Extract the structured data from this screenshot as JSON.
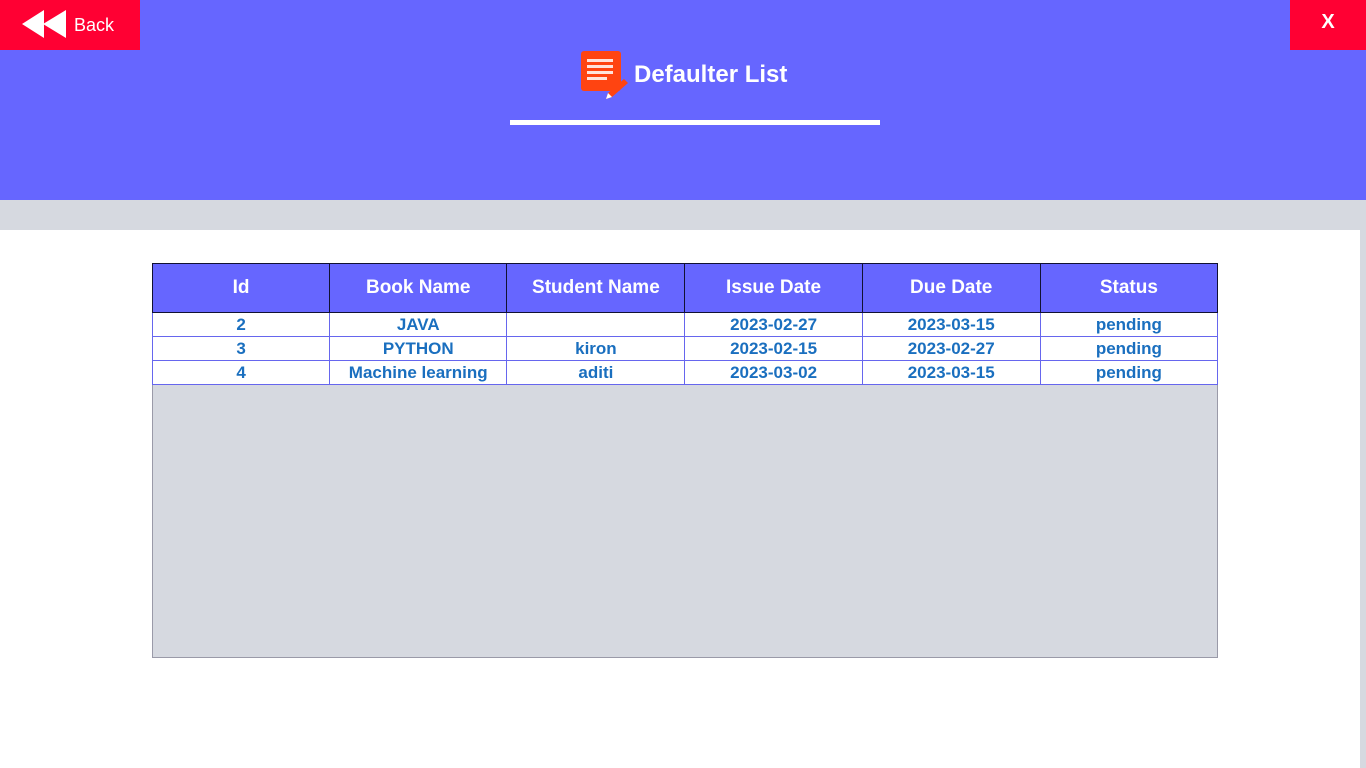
{
  "header": {
    "back_label": "Back",
    "close_label": "X",
    "title": "Defaulter List"
  },
  "colors": {
    "header_bg": "#6666ff",
    "button_bg": "#ff0033",
    "cell_text": "#1a6fbf",
    "grid_bg": "#d6d9e0",
    "icon_accent": "#ff4411"
  },
  "icons": {
    "back": "rewind-icon",
    "title": "list-document-icon"
  },
  "table": {
    "columns": [
      "Id",
      "Book Name",
      "Student Name",
      "Issue Date",
      "Due Date",
      "Status"
    ],
    "rows": [
      [
        "2",
        "JAVA",
        "",
        "2023-02-27",
        "2023-03-15",
        "pending"
      ],
      [
        "3",
        "PYTHON",
        "kiron",
        "2023-02-15",
        "2023-02-27",
        "pending"
      ],
      [
        "4",
        "Machine learning",
        "aditi",
        "2023-03-02",
        "2023-03-15",
        "pending"
      ]
    ]
  }
}
